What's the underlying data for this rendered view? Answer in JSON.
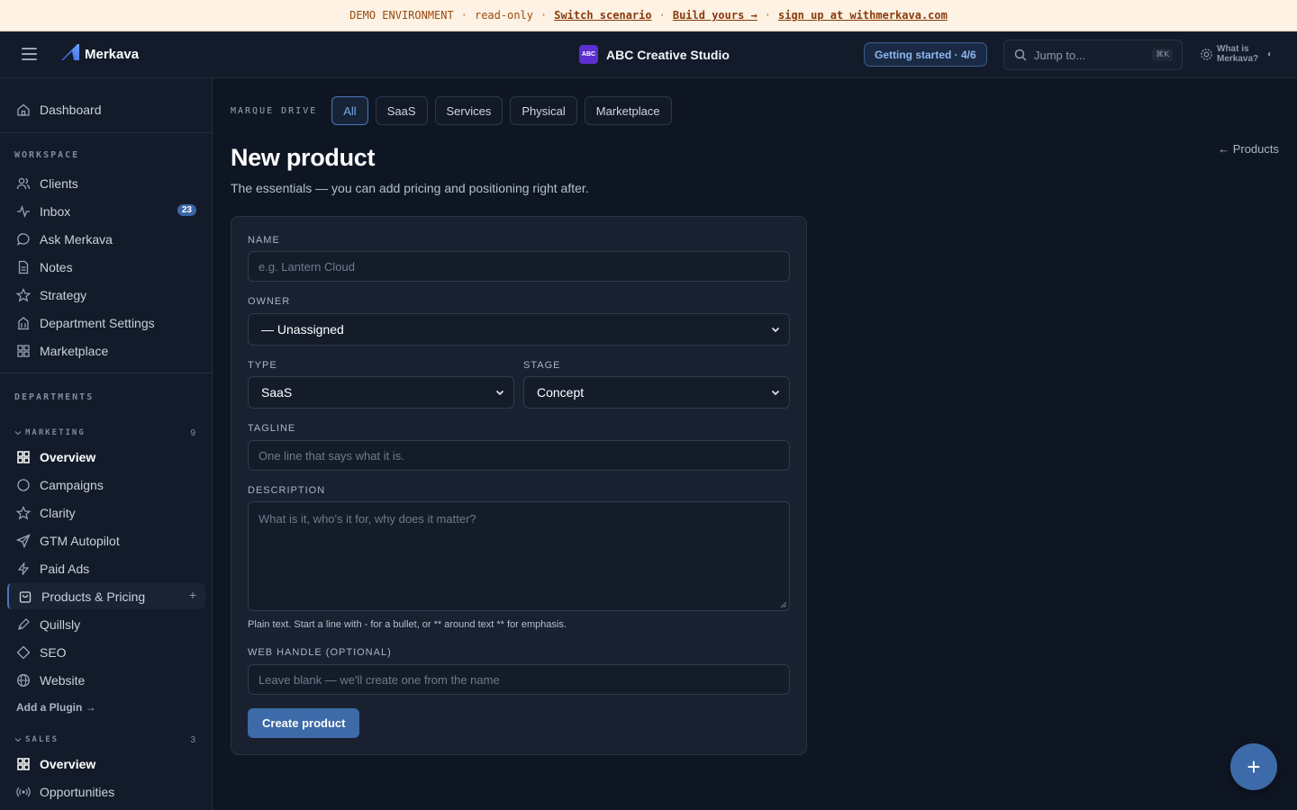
{
  "banner": {
    "env": "DEMO ENVIRONMENT",
    "mode": "read-only",
    "switch": "Switch scenario",
    "build": "Build yours →",
    "signup": "sign up at withmerkava.com",
    "sep": "·"
  },
  "topbar": {
    "logo": "Merkava",
    "org_badge": "ABC",
    "org_name": "ABC Creative Studio",
    "getting_started": "Getting started · 4/6",
    "search_placeholder": "Jump to...",
    "search_shortcut": "⌘K",
    "what_is": "What is Merkava?",
    "theme_icon": "◐"
  },
  "sidebar": {
    "dashboard": "Dashboard",
    "workspace_label": "WORKSPACE",
    "workspace": [
      {
        "label": "Clients"
      },
      {
        "label": "Inbox",
        "badge": "23"
      },
      {
        "label": "Ask Merkava"
      },
      {
        "label": "Notes"
      },
      {
        "label": "Strategy"
      },
      {
        "label": "Department Settings"
      },
      {
        "label": "Marketplace"
      }
    ],
    "departments_label": "DEPARTMENTS",
    "marketing": {
      "label": "MARKETING",
      "count": "9",
      "items": [
        {
          "label": "Overview"
        },
        {
          "label": "Campaigns"
        },
        {
          "label": "Clarity"
        },
        {
          "label": "GTM Autopilot"
        },
        {
          "label": "Paid Ads"
        },
        {
          "label": "Products & Pricing",
          "plus": "+"
        },
        {
          "label": "Quillsly"
        },
        {
          "label": "SEO"
        },
        {
          "label": "Website"
        }
      ],
      "add_plugin": "Add a Plugin →"
    },
    "sales": {
      "label": "SALES",
      "count": "3",
      "items": [
        {
          "label": "Overview"
        },
        {
          "label": "Opportunities"
        }
      ]
    }
  },
  "main": {
    "filter_label": "MARQUE DRIVE",
    "filters": [
      "All",
      "SaaS",
      "Services",
      "Physical",
      "Marketplace"
    ],
    "back": "← Products",
    "title": "New product",
    "subtitle": "The essentials — you can add pricing and positioning right after.",
    "form": {
      "name_label": "NAME",
      "name_placeholder": "e.g. Lantern Cloud",
      "owner_label": "OWNER",
      "owner_value": "— Unassigned",
      "type_label": "TYPE",
      "type_value": "SaaS",
      "stage_label": "STAGE",
      "stage_value": "Concept",
      "tagline_label": "TAGLINE",
      "tagline_placeholder": "One line that says what it is.",
      "description_label": "DESCRIPTION",
      "description_placeholder": "What is it, who's it for, why does it matter?",
      "hint": "Plain text. Start a line with - for a bullet, or ** around text ** for emphasis.",
      "handle_label": "WEB HANDLE (OPTIONAL)",
      "handle_placeholder": "Leave blank — we'll create one from the name",
      "submit": "Create product"
    },
    "fab": "+"
  },
  "colors": {
    "accent": "#3d6aa8",
    "background": "#0f1623",
    "sidebar": "#131b2a",
    "banner": "#fdf2e3"
  }
}
